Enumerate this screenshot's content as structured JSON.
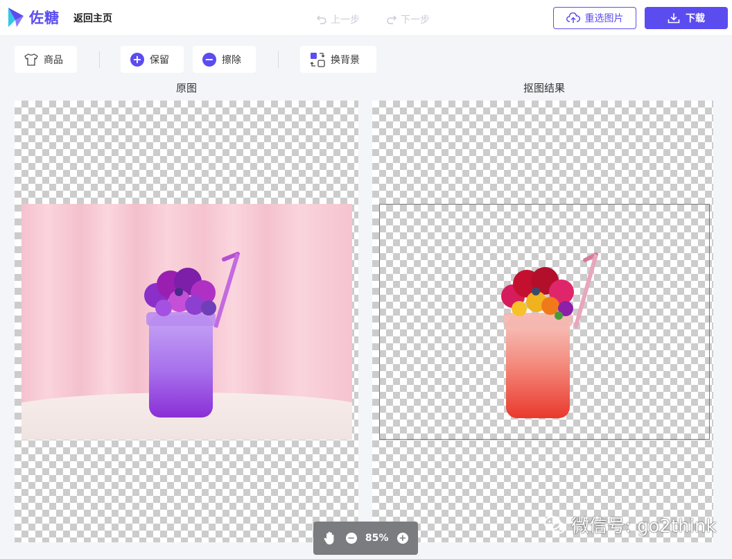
{
  "header": {
    "logo_text": "佐糖",
    "back_home": "返回主页",
    "undo": "上一步",
    "redo": "下一步",
    "reselect": "重选图片",
    "download": "下载"
  },
  "toolbar": {
    "product": "商品",
    "keep": "保留",
    "erase": "擦除",
    "change_bg": "换背景"
  },
  "panels": {
    "original_title": "原图",
    "result_title": "抠图结果"
  },
  "zoom": {
    "level": "85%"
  },
  "watermark": {
    "text": "微信号: go2think"
  },
  "colors": {
    "accent": "#5b4cf0"
  }
}
